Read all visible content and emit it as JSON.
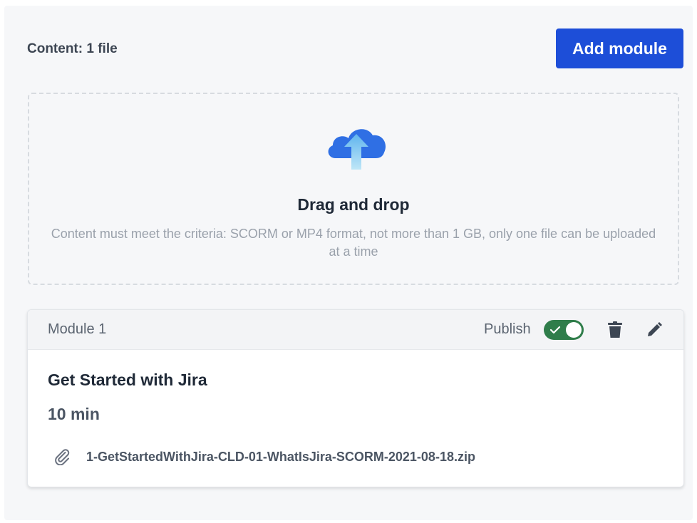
{
  "content": {
    "count_label": "Content: 1 file"
  },
  "actions": {
    "add_module_label": "Add module"
  },
  "dropzone": {
    "title": "Drag and drop",
    "description": "Content must meet the criteria: SCORM or MP4 format, not more than 1 GB, only one file can be uploaded at a time",
    "icon": "cloud-upload-icon"
  },
  "module": {
    "label": "Module 1",
    "publish_label": "Publish",
    "published": true,
    "title": "Get Started with Jira",
    "duration": "10 min",
    "file_name": "1-GetStartedWithJira-CLD-01-WhatIsJira-SCORM-2021-08-18.zip",
    "icons": {
      "delete": "trash-icon",
      "edit": "pencil-icon",
      "attachment": "paperclip-icon"
    }
  },
  "colors": {
    "accent": "#1d4ed8",
    "toggle_on": "#2f7d4a",
    "panel_bg": "#f6f7f9"
  }
}
